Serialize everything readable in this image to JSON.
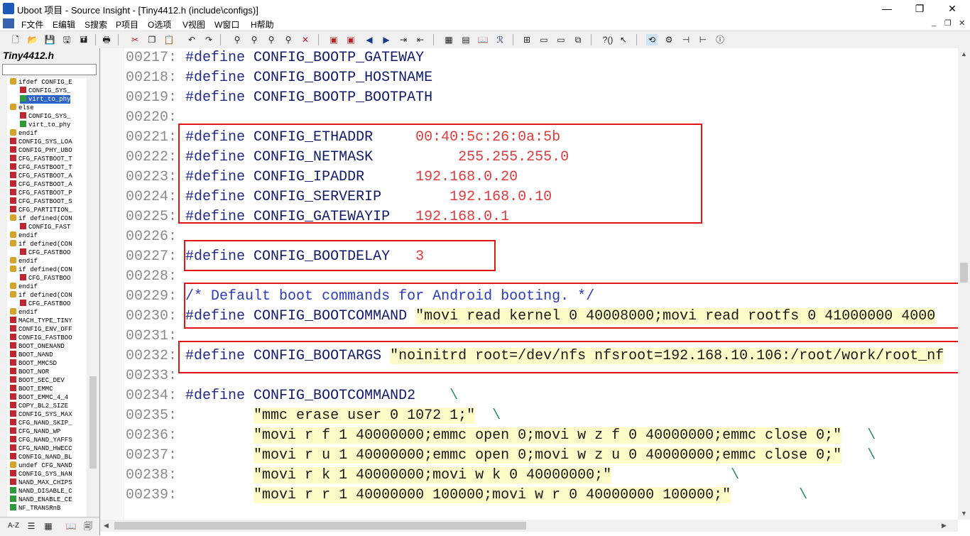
{
  "window": {
    "title": "Uboot 项目 - Source Insight - [Tiny4412.h (include\\configs)]",
    "minimize": "—",
    "restore": "❐",
    "close": "✕"
  },
  "menu": {
    "items": [
      "F文件",
      "E编辑",
      "S搜索",
      "P项目",
      "O选项",
      "V视图",
      "W窗口",
      "H帮助"
    ],
    "mdi": [
      "_",
      "❐",
      "✕"
    ]
  },
  "toolbar": {
    "icons": [
      "new-file",
      "open-file",
      "save",
      "save-as",
      "save-all",
      "print",
      "cut",
      "copy",
      "paste",
      "undo",
      "redo",
      "find",
      "find-next",
      "find-previous",
      "replace",
      "lookup",
      "bookmark-toggle",
      "bookmark-next",
      "back",
      "forward",
      "indent",
      "outdent",
      "project-window",
      "symbol-window",
      "relation-window",
      "context-window",
      "layout-1",
      "layout-2",
      "layout-3",
      "layout-4",
      "help-context",
      "help-pointer",
      "sync",
      "browse",
      "relation",
      "call-graph",
      "info"
    ]
  },
  "left_panel": {
    "file_name": "Tiny4412.h",
    "search_placeholder": "",
    "symbols": [
      {
        "type": "cond",
        "label": "ifdef CONFIG_E",
        "indent": 1
      },
      {
        "type": "def",
        "label": "CONFIG_SYS_",
        "indent": 2
      },
      {
        "type": "mac",
        "label": "virt_to_phy",
        "indent": 2,
        "selected": true
      },
      {
        "type": "cond",
        "label": "else",
        "indent": 1
      },
      {
        "type": "def",
        "label": "CONFIG_SYS_",
        "indent": 2
      },
      {
        "type": "mac",
        "label": "virt_to_phy",
        "indent": 2
      },
      {
        "type": "cond",
        "label": "endif",
        "indent": 1
      },
      {
        "type": "def",
        "label": "CONFIG_SYS_LOA",
        "indent": 1
      },
      {
        "type": "def",
        "label": "CONFIG_PHY_UBO",
        "indent": 1
      },
      {
        "type": "def",
        "label": "CFG_FASTBOOT_T",
        "indent": 1
      },
      {
        "type": "def",
        "label": "CFG_FASTBOOT_T",
        "indent": 1
      },
      {
        "type": "def",
        "label": "CFG_FASTBOOT_A",
        "indent": 1
      },
      {
        "type": "def",
        "label": "CFG_FASTBOOT_A",
        "indent": 1
      },
      {
        "type": "def",
        "label": "CFG_FASTBOOT_P",
        "indent": 1
      },
      {
        "type": "def",
        "label": "CFG_FASTBOOT_S",
        "indent": 1
      },
      {
        "type": "def",
        "label": "CFG_PARTITION_",
        "indent": 1
      },
      {
        "type": "cond",
        "label": "if defined(CON",
        "indent": 1
      },
      {
        "type": "def",
        "label": "CONFIG_FAST",
        "indent": 2
      },
      {
        "type": "cond",
        "label": "endif",
        "indent": 1
      },
      {
        "type": "cond",
        "label": "if defined(CON",
        "indent": 1
      },
      {
        "type": "def",
        "label": "CFG_FASTBOO",
        "indent": 2
      },
      {
        "type": "cond",
        "label": "endif",
        "indent": 1
      },
      {
        "type": "cond",
        "label": "if defined(CON",
        "indent": 1
      },
      {
        "type": "def",
        "label": "CFG_FASTBOO",
        "indent": 2
      },
      {
        "type": "cond",
        "label": "endif",
        "indent": 1
      },
      {
        "type": "cond",
        "label": "if defined(CON",
        "indent": 1
      },
      {
        "type": "def",
        "label": "CFG_FASTBOO",
        "indent": 2
      },
      {
        "type": "cond",
        "label": "endif",
        "indent": 1
      },
      {
        "type": "def",
        "label": "MACH_TYPE_TINY",
        "indent": 1
      },
      {
        "type": "def",
        "label": "CONFIG_ENV_OFF",
        "indent": 1
      },
      {
        "type": "def",
        "label": "CONFIG_FASTBOO",
        "indent": 1
      },
      {
        "type": "def",
        "label": "BOOT_ONENAND",
        "indent": 1
      },
      {
        "type": "def",
        "label": "BOOT_NAND",
        "indent": 1
      },
      {
        "type": "def",
        "label": "BOOT_MMCSD",
        "indent": 1
      },
      {
        "type": "def",
        "label": "BOOT_NOR",
        "indent": 1
      },
      {
        "type": "def",
        "label": "BOOT_SEC_DEV",
        "indent": 1
      },
      {
        "type": "def",
        "label": "BOOT_EMMC",
        "indent": 1
      },
      {
        "type": "def",
        "label": "BOOT_EMMC_4_4",
        "indent": 1
      },
      {
        "type": "def",
        "label": "COPY_BL2_SIZE",
        "indent": 1
      },
      {
        "type": "def",
        "label": "CONFIG_SYS_MAX",
        "indent": 1
      },
      {
        "type": "def",
        "label": "CFG_NAND_SKIP_",
        "indent": 1
      },
      {
        "type": "def",
        "label": "CFG_NAND_WP",
        "indent": 1
      },
      {
        "type": "def",
        "label": "CFG_NAND_YAFFS",
        "indent": 1
      },
      {
        "type": "def",
        "label": "CFG_NAND_HWECC",
        "indent": 1
      },
      {
        "type": "def",
        "label": "CONFIG_NAND_BL",
        "indent": 1
      },
      {
        "type": "cond",
        "label": "undef CFG_NAND",
        "indent": 1
      },
      {
        "type": "def",
        "label": "CONFIG_SYS_NAN",
        "indent": 1
      },
      {
        "type": "def",
        "label": "NAND_MAX_CHIPS",
        "indent": 1
      },
      {
        "type": "mac",
        "label": "NAND_DISABLE_C",
        "indent": 1
      },
      {
        "type": "mac",
        "label": "NAND_ENABLE_CE",
        "indent": 1
      },
      {
        "type": "mac",
        "label": "NF_TRANSRnB",
        "indent": 1
      }
    ],
    "bottom_icons": [
      "sort-az-icon",
      "list-icon",
      "category-icon",
      "book-icon",
      "bookmark-icon"
    ],
    "bottom_label": "A-Z"
  },
  "code": {
    "lines": [
      {
        "n": "00217:",
        "seg": [
          [
            "kw",
            "#define "
          ],
          [
            "mn",
            "CONFIG_BOOTP_GATEWAY"
          ]
        ]
      },
      {
        "n": "00218:",
        "seg": [
          [
            "kw",
            "#define "
          ],
          [
            "mn",
            "CONFIG_BOOTP_HOSTNAME"
          ]
        ]
      },
      {
        "n": "00219:",
        "seg": [
          [
            "kw",
            "#define "
          ],
          [
            "mn",
            "CONFIG_BOOTP_BOOTPATH"
          ]
        ]
      },
      {
        "n": "00220:",
        "seg": []
      },
      {
        "n": "00221:",
        "seg": [
          [
            "kw",
            "#define "
          ],
          [
            "mn",
            "CONFIG_ETHADDR"
          ],
          [
            "sp",
            "     "
          ],
          [
            "val",
            "00:40:5c:26:0a:5b"
          ]
        ]
      },
      {
        "n": "00222:",
        "seg": [
          [
            "kw",
            "#define "
          ],
          [
            "mn",
            "CONFIG_NETMASK"
          ],
          [
            "sp",
            "          "
          ],
          [
            "val",
            "255.255.255.0"
          ]
        ]
      },
      {
        "n": "00223:",
        "seg": [
          [
            "kw",
            "#define "
          ],
          [
            "mn",
            "CONFIG_IPADDR"
          ],
          [
            "sp",
            "      "
          ],
          [
            "val",
            "192.168.0.20"
          ]
        ]
      },
      {
        "n": "00224:",
        "seg": [
          [
            "kw",
            "#define "
          ],
          [
            "mn",
            "CONFIG_SERVERIP"
          ],
          [
            "sp",
            "        "
          ],
          [
            "val",
            "192.168.0.10"
          ]
        ]
      },
      {
        "n": "00225:",
        "seg": [
          [
            "kw",
            "#define "
          ],
          [
            "mn",
            "CONFIG_GATEWAYIP"
          ],
          [
            "sp",
            "   "
          ],
          [
            "val",
            "192.168.0.1"
          ]
        ]
      },
      {
        "n": "00226:",
        "seg": []
      },
      {
        "n": "00227:",
        "seg": [
          [
            "kw",
            "#define "
          ],
          [
            "mn",
            "CONFIG_BOOTDELAY"
          ],
          [
            "sp",
            "   "
          ],
          [
            "val",
            "3"
          ]
        ]
      },
      {
        "n": "00228:",
        "seg": []
      },
      {
        "n": "00229:",
        "seg": [
          [
            "cm",
            "/* Default boot commands for Android booting. */"
          ]
        ]
      },
      {
        "n": "00230:",
        "seg": [
          [
            "kw",
            "#define "
          ],
          [
            "mn",
            "CONFIG_BOOTCOMMAND"
          ],
          [
            "sp",
            " "
          ],
          [
            "str",
            "\"movi read kernel 0 40008000;movi read rootfs 0 41000000 4000"
          ]
        ]
      },
      {
        "n": "00231:",
        "seg": []
      },
      {
        "n": "00232:",
        "seg": [
          [
            "kw",
            "#define "
          ],
          [
            "mn",
            "CONFIG_BOOTARGS"
          ],
          [
            "sp",
            " "
          ],
          [
            "str",
            "\"noinitrd root=/dev/nfs nfsroot=192.168.10.106:/root/work/root_nf"
          ]
        ]
      },
      {
        "n": "00233:",
        "seg": []
      },
      {
        "n": "00234:",
        "seg": [
          [
            "kw",
            "#define "
          ],
          [
            "mn",
            "CONFIG_BOOTCOMMAND2"
          ],
          [
            "sp",
            "    "
          ],
          [
            "bs",
            "\\"
          ]
        ]
      },
      {
        "n": "00235:",
        "seg": [
          [
            "sp",
            "        "
          ],
          [
            "str",
            "\"mmc erase user 0 1072 1;\""
          ],
          [
            "sp",
            "  "
          ],
          [
            "bs",
            "\\"
          ]
        ]
      },
      {
        "n": "00236:",
        "seg": [
          [
            "sp",
            "        "
          ],
          [
            "str",
            "\"movi r f 1 40000000;emmc open 0;movi w z f 0 40000000;emmc close 0;\""
          ],
          [
            "sp",
            "   "
          ],
          [
            "bs",
            "\\"
          ]
        ]
      },
      {
        "n": "00237:",
        "seg": [
          [
            "sp",
            "        "
          ],
          [
            "str",
            "\"movi r u 1 40000000;emmc open 0;movi w z u 0 40000000;emmc close 0;\""
          ],
          [
            "sp",
            "   "
          ],
          [
            "bs",
            "\\"
          ]
        ]
      },
      {
        "n": "00238:",
        "seg": [
          [
            "sp",
            "        "
          ],
          [
            "str",
            "\"movi r k 1 40000000;movi w k 0 40000000;\""
          ],
          [
            "sp",
            "              "
          ],
          [
            "bs",
            "\\"
          ]
        ]
      },
      {
        "n": "00239:",
        "seg": [
          [
            "sp",
            "        "
          ],
          [
            "str",
            "\"movi r r 1 40000000 100000;movi w r 0 40000000 100000;\""
          ],
          [
            "sp",
            "        "
          ],
          [
            "bs",
            "\\"
          ]
        ]
      }
    ]
  }
}
